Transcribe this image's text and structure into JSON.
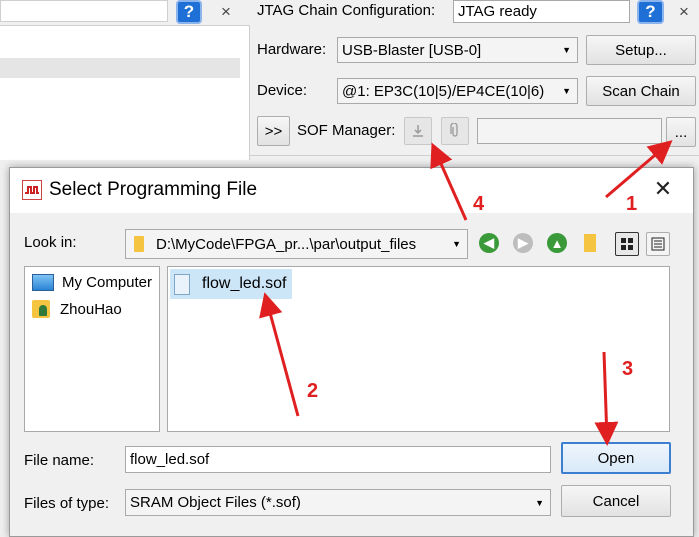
{
  "top_left": {
    "close_glyph": "×"
  },
  "jtag": {
    "config_label": "JTAG Chain Configuration:",
    "status": "JTAG ready",
    "hardware_label": "Hardware:",
    "hardware_value": "USB-Blaster [USB-0]",
    "setup_button": "Setup...",
    "device_label": "Device:",
    "device_value": "@1: EP3C(10|5)/EP4CE(10|6)",
    "scan_chain_button": "Scan Chain",
    "expand_button": ">>",
    "sof_manager_label": "SOF Manager:",
    "browse_button": "...",
    "close_glyph": "×",
    "help_glyph": "?"
  },
  "dialog": {
    "title": "Select Programming File",
    "close_glyph": "✕",
    "look_in_label": "Look in:",
    "look_in_value": "D:\\MyCode\\FPGA_pr...\\par\\output_files",
    "sidebar": [
      {
        "label": "My Computer",
        "icon": "computer-icon"
      },
      {
        "label": "ZhouHao",
        "icon": "user-folder-icon"
      }
    ],
    "files": [
      {
        "name": "flow_led.sof",
        "icon": "file-icon"
      }
    ],
    "file_name_label": "File name:",
    "file_name_value": "flow_led.sof",
    "files_of_type_label": "Files of type:",
    "files_of_type_value": "SRAM Object Files (*.sof)",
    "open_button": "Open",
    "cancel_button": "Cancel"
  },
  "annotations": [
    "1",
    "2",
    "3",
    "4"
  ],
  "colors": {
    "accent": "#1e6fd6",
    "annotation": "#e02020",
    "selection": "#cde6f7"
  }
}
